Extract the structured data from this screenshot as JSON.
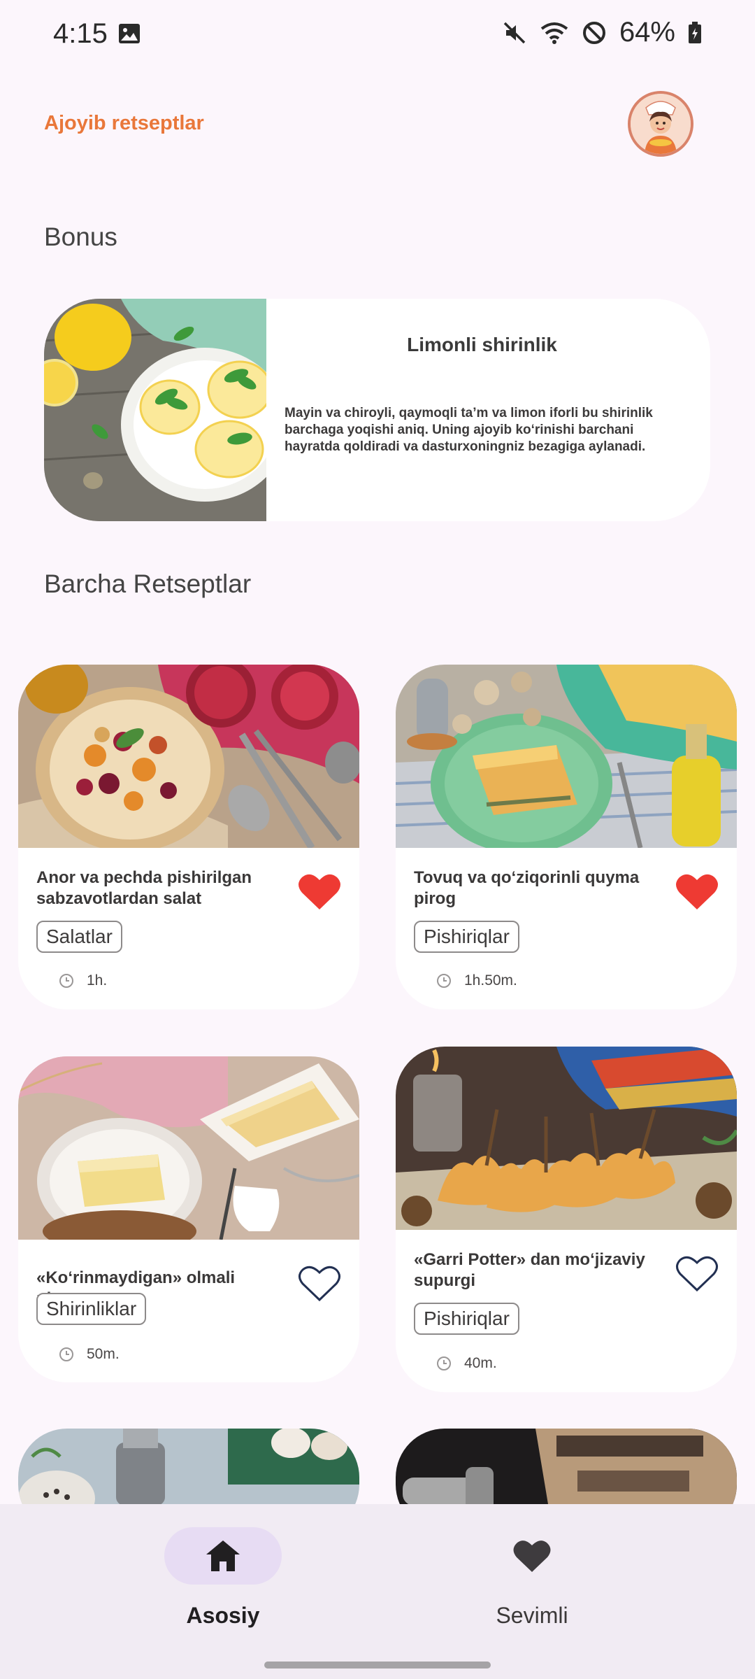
{
  "status_bar": {
    "time": "4:15",
    "battery": "64%"
  },
  "header": {
    "app_title": "Ajoyib retseptlar",
    "avatar_icon": "chef-avatar-icon"
  },
  "bonus": {
    "section_title": "Bonus",
    "card": {
      "title": "Limonli shirinlik",
      "description": "Mayin va chiroyli, qaymoqli ta’m va limon iforli bu shirinlik barchaga yoqishi aniq. Uning ajoyib ko‘rinishi barchani hayratda qoldiradi va dasturxoningniz bezagiga aylanadi."
    }
  },
  "all_recipes": {
    "section_title": "Barcha Retseptlar",
    "cards": [
      {
        "title": "Anor va pechda pishirilgan sabzavotlardan salat",
        "category": "Salatlar",
        "time": "1h.",
        "favorite": true
      },
      {
        "title": "Tovuq va qo‘ziqorinli quyma pirog",
        "category": "Pishiriqlar",
        "time": "1h.50m.",
        "favorite": true
      },
      {
        "title": "«Ko‘rinmaydigan» olmali pirog",
        "category": "Shirinliklar",
        "time": "50m.",
        "favorite": false
      },
      {
        "title": "«Garri Potter» dan mo‘jizaviy supurgi",
        "category": "Pishiriqlar",
        "time": "40m.",
        "favorite": false
      }
    ]
  },
  "bottom_nav": {
    "items": [
      {
        "label": "Asosiy",
        "icon": "home-icon",
        "active": true
      },
      {
        "label": "Sevimli",
        "icon": "heart-icon",
        "active": false
      }
    ]
  },
  "colors": {
    "accent": "#e9773a",
    "heart_filled": "#ee3a33",
    "background": "#fcf6fc",
    "nav_background": "#f1ebf3",
    "nav_active_pill": "#e7dcf3"
  }
}
